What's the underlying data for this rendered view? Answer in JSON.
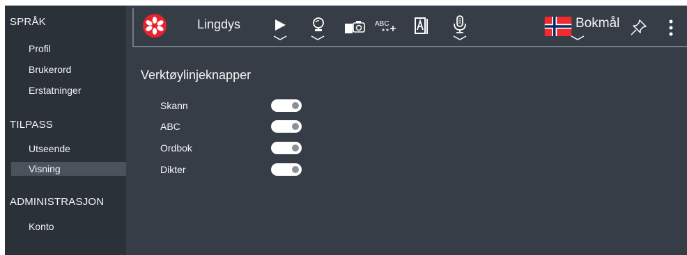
{
  "sidebar": {
    "sections": [
      {
        "title": "SPRÅK",
        "items": [
          "Profil",
          "Brukerord",
          "Erstatninger"
        ]
      },
      {
        "title": "TILPASS",
        "items": [
          "Utseende",
          "Visning"
        ]
      },
      {
        "title": "ADMINISTRASJON",
        "items": [
          "Konto"
        ]
      }
    ],
    "selected_item": "Visning"
  },
  "toolbar": {
    "app_name": "Lingdys",
    "abc_icon_text": "ABC",
    "language": "Bokmål",
    "icons": [
      "logo-flower-icon",
      "play-icon",
      "search-globe-icon",
      "scan-camera-icon",
      "abc-spellcheck-icon",
      "dictionary-book-icon",
      "microphone-icon",
      "norway-flag-icon",
      "pin-icon",
      "more-vertical-icon"
    ]
  },
  "main": {
    "heading": "Verktøylinjeknapper",
    "options": [
      {
        "label": "Skann",
        "enabled": true
      },
      {
        "label": "ABC",
        "enabled": true
      },
      {
        "label": "Ordbok",
        "enabled": true
      },
      {
        "label": "Dikter",
        "enabled": true
      }
    ]
  },
  "colors": {
    "sidebar_bg": "#2b3138",
    "main_bg": "#363d46",
    "selected_bg": "#4a525c",
    "logo_red": "#e8222f",
    "toggle_on": "#ffffff",
    "knob": "#8c9096"
  }
}
